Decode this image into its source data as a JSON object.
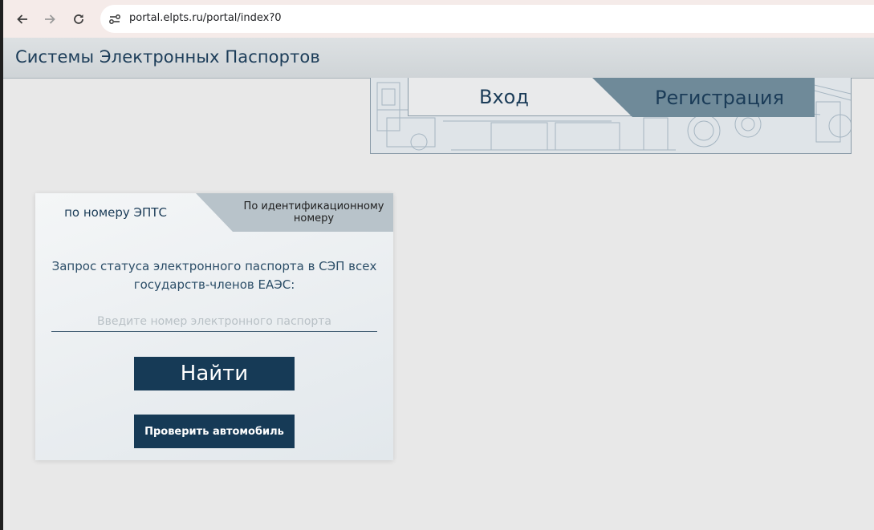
{
  "browser": {
    "url": "portal.elpts.ru/portal/index?0"
  },
  "header": {
    "title": "Системы Электронных Паспортов"
  },
  "auth_tabs": {
    "login": "Вход",
    "register": "Регистрация"
  },
  "search_card": {
    "tabs": {
      "by_epts": "по номеру ЭПТС",
      "by_id": "По идентификационному номеру"
    },
    "description": "Запрос статуса электронного паспорта в СЭП всех государств-членов ЕАЭС:",
    "input": {
      "value": "",
      "placeholder": "Введите номер электронного паспорта"
    },
    "find_button": "Найти",
    "check_button": "Проверить автомобиль"
  },
  "colors": {
    "brand_dark": "#163a56",
    "header_text": "#1b3c58",
    "register_tab": "#6f8a99",
    "inactive_tab": "#b8c3ca"
  }
}
